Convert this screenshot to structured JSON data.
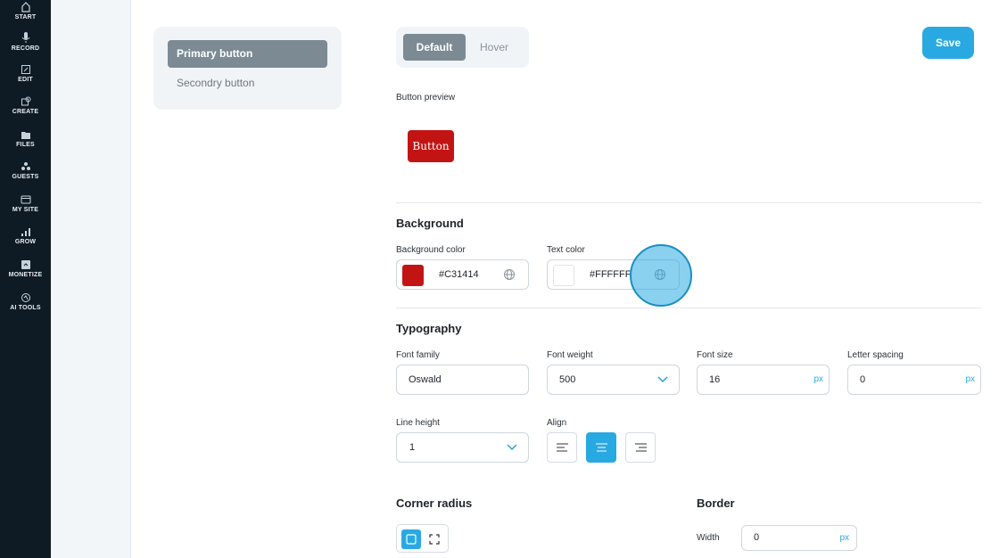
{
  "nav": {
    "items": [
      {
        "label": "START",
        "icon": "home-icon"
      },
      {
        "label": "RECORD",
        "icon": "microphone-icon"
      },
      {
        "label": "EDIT",
        "icon": "edit-icon"
      },
      {
        "label": "CREATE",
        "icon": "create-icon"
      },
      {
        "label": "FILES",
        "icon": "files-icon"
      },
      {
        "label": "GUESTS",
        "icon": "guests-icon"
      },
      {
        "label": "MY SITE",
        "icon": "site-icon"
      },
      {
        "label": "GROW",
        "icon": "chart-icon"
      },
      {
        "label": "MONETIZE",
        "icon": "monetize-icon"
      },
      {
        "label": "AI TOOLS",
        "icon": "ai-icon"
      }
    ]
  },
  "button_tabs": {
    "primary": "Primary button",
    "secondary": "Secondry button"
  },
  "state_tabs": {
    "default": "Default",
    "hover": "Hover"
  },
  "toolbar": {
    "save_label": "Save"
  },
  "preview": {
    "label": "Button preview",
    "button_text": "Button"
  },
  "background": {
    "heading": "Background",
    "bg_color_label": "Background color",
    "bg_color_value": "#C31414",
    "text_color_label": "Text color",
    "text_color_value": "#FFFFFF"
  },
  "typography": {
    "heading": "Typography",
    "font_family_label": "Font family",
    "font_family_value": "Oswald",
    "font_weight_label": "Font weight",
    "font_weight_value": "500",
    "font_size_label": "Font size",
    "font_size_value": "16",
    "font_size_unit": "px",
    "letter_spacing_label": "Letter spacing",
    "letter_spacing_value": "0",
    "letter_spacing_unit": "px",
    "line_height_label": "Line height",
    "line_height_value": "1",
    "align_label": "Align",
    "align_selected": "center"
  },
  "corner": {
    "heading": "Corner radius"
  },
  "border": {
    "heading": "Border",
    "width_label": "Width",
    "width_value": "0",
    "width_unit": "px"
  },
  "colors": {
    "accent": "#29a9e1",
    "sidebar": "#0f1b24",
    "tab_active": "#7b8a93"
  }
}
